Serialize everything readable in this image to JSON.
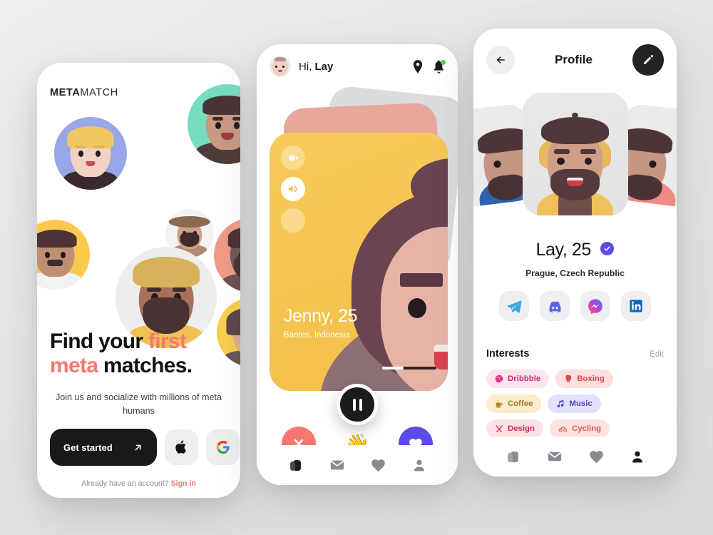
{
  "app": {
    "background_color": "#e6e6e6",
    "accent_coral": "#f9776d",
    "accent_purple": "#5b4ce6",
    "accent_yellow": "#f5c44f"
  },
  "screen_onboarding": {
    "brand_bold": "META",
    "brand_light": "MATCH",
    "headline_line1_a": "Find your ",
    "headline_line1_b": "first",
    "headline_line2_a": "meta",
    "headline_line2_b": " matches.",
    "subtitle": "Join us and socialize with millions of meta humans",
    "get_started_label": "Get started",
    "arrow_icon": "arrow-up-right-icon",
    "apple_icon": "apple-logo-icon",
    "google_icon": "google-logo-icon",
    "footer_prefix": "Already have an account? ",
    "footer_link": "Sign in",
    "avatars": [
      {
        "name": "avatar-blond-man",
        "bg": "#98a7e8"
      },
      {
        "name": "avatar-cap-man",
        "bg": "#76ddc1"
      },
      {
        "name": "avatar-hat-man",
        "bg": "#f3f3f3"
      },
      {
        "name": "avatar-glasses-man",
        "bg": "#fbc94f"
      },
      {
        "name": "avatar-beard-man",
        "bg": "#ef9b87"
      },
      {
        "name": "avatar-turban-man",
        "bg": "#ededee"
      },
      {
        "name": "avatar-glasses-woman",
        "bg": "#f8cf4d"
      }
    ]
  },
  "screen_call": {
    "greeting_prefix": "Hi, ",
    "greeting_name": "Lay",
    "avatar_name": "user-avatar",
    "location_icon": "location-pin-icon",
    "notification_icon": "bell-icon",
    "notification_badge": true,
    "side_controls": [
      {
        "name": "video-camera-icon",
        "state": "dim"
      },
      {
        "name": "speaker-icon",
        "state": "active"
      },
      {
        "name": "microphone-muted-icon",
        "state": "dim"
      }
    ],
    "card_name": "Jenny,",
    "card_age": "25",
    "card_location": "Banten, Indonesia",
    "play_icon": "pause-icon",
    "progress_percent": 40,
    "actions": [
      {
        "name": "reject-button",
        "icon": "close-icon",
        "color": "#f8776e"
      },
      {
        "name": "wave-button",
        "icon": "waving-hand-emoji",
        "color": "transparent"
      },
      {
        "name": "like-button",
        "icon": "heart-icon",
        "color": "#5b4ce6"
      }
    ],
    "tabs": [
      {
        "name": "tab-cards",
        "icon": "cards-stack-icon",
        "active": true
      },
      {
        "name": "tab-messages",
        "icon": "envelope-icon",
        "active": false
      },
      {
        "name": "tab-likes",
        "icon": "heart-icon",
        "active": false
      },
      {
        "name": "tab-profile",
        "icon": "person-icon",
        "active": false
      }
    ]
  },
  "screen_profile": {
    "back_icon": "arrow-left-icon",
    "title": "Profile",
    "edit_icon": "pencil-icon",
    "name": "Lay,",
    "age": "25",
    "verified_icon": "check-badge-icon",
    "location": "Prague, Czech Republic",
    "socials": [
      {
        "name": "telegram-icon",
        "label": "Telegram",
        "color": "#3aa8e0"
      },
      {
        "name": "discord-icon",
        "label": "Discord",
        "color": "#5865f2"
      },
      {
        "name": "messenger-icon",
        "label": "Messenger",
        "color": "#b13cf0"
      },
      {
        "name": "linkedin-icon",
        "label": "LinkedIn",
        "color": "#0a66c2"
      }
    ],
    "interests_title": "Interests",
    "interests_edit": "Edit",
    "interests": [
      {
        "label": "Dribbble",
        "icon": "dribbble-icon",
        "bg": "#fbe4ee",
        "fg": "#d4266f"
      },
      {
        "label": "Boxing",
        "icon": "boxing-glove-icon",
        "bg": "#fde0dd",
        "fg": "#e0484f"
      },
      {
        "label": "Coffee",
        "icon": "coffee-cup-icon",
        "bg": "#fbeccb",
        "fg": "#a77b1c"
      },
      {
        "label": "Music",
        "icon": "music-note-icon",
        "bg": "#e2e1f9",
        "fg": "#4a45c9"
      },
      {
        "label": "Design",
        "icon": "design-tools-icon",
        "bg": "#fde2e5",
        "fg": "#d6255c"
      },
      {
        "label": "Cycling",
        "icon": "bicycle-icon",
        "bg": "#fde2e1",
        "fg": "#e3564e"
      }
    ],
    "tabs": [
      {
        "name": "tab-cards",
        "icon": "cards-stack-icon",
        "active": false
      },
      {
        "name": "tab-messages",
        "icon": "envelope-icon",
        "active": false
      },
      {
        "name": "tab-likes",
        "icon": "heart-icon",
        "active": false
      },
      {
        "name": "tab-profile",
        "icon": "person-icon",
        "active": true
      }
    ]
  }
}
